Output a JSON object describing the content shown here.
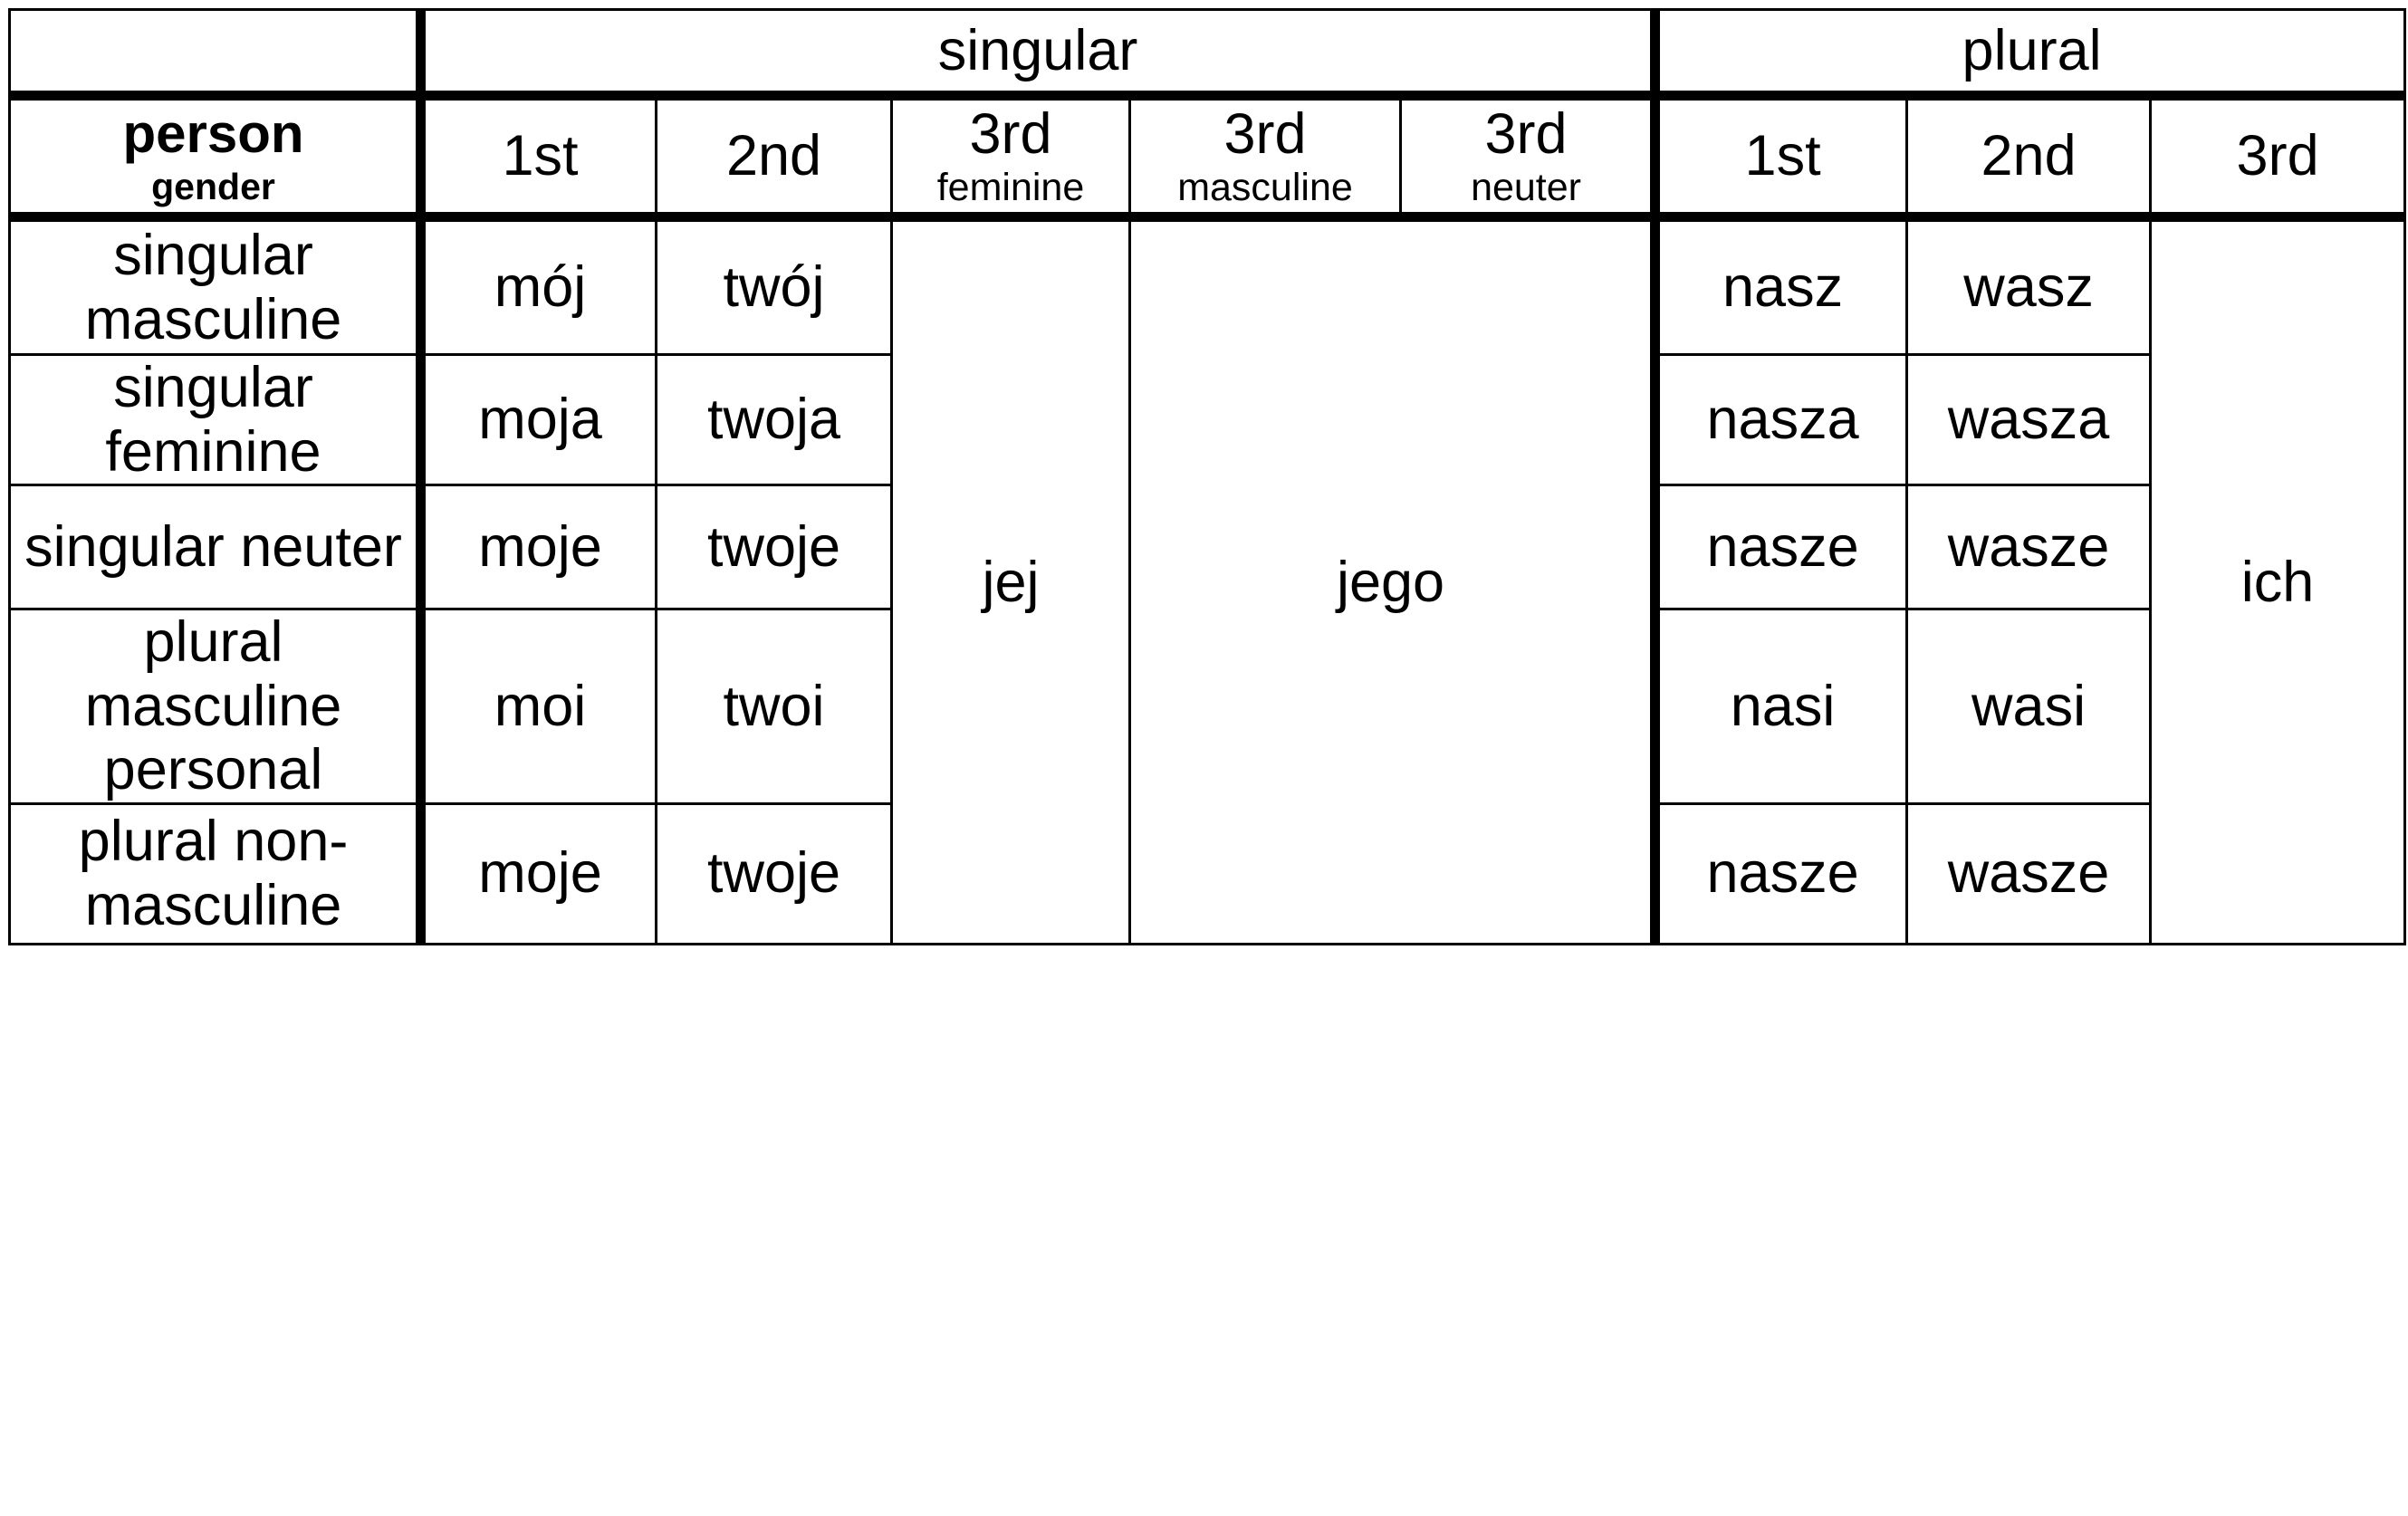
{
  "table": {
    "corner": {
      "person_label": "person",
      "gender_label": "gender"
    },
    "number_groups": [
      {
        "label": "singular",
        "span": 5
      },
      {
        "label": "plural",
        "span": 3
      }
    ],
    "person_columns": [
      {
        "main": "1st",
        "sub": ""
      },
      {
        "main": "2nd",
        "sub": ""
      },
      {
        "main": "3rd",
        "sub": "feminine"
      },
      {
        "main": "3rd",
        "sub": "masculine"
      },
      {
        "main": "3rd",
        "sub": "neuter"
      },
      {
        "main": "1st",
        "sub": ""
      },
      {
        "main": "2nd",
        "sub": ""
      },
      {
        "main": "3rd",
        "sub": ""
      }
    ],
    "row_labels": [
      "singular masculine",
      "singular feminine",
      "singular neuter",
      "plural masculine personal",
      "plural non-masculine"
    ],
    "cells": {
      "sg_1st": [
        "mój",
        "moja",
        "moje",
        "moi",
        "moje"
      ],
      "sg_2nd": [
        "twój",
        "twoja",
        "twoje",
        "twoi",
        "twoje"
      ],
      "sg_3rd_feminine": "jej",
      "sg_3rd_masculine_neuter": "jego",
      "pl_1st": [
        "nasz",
        "nasza",
        "nasze",
        "nasi",
        "nasze"
      ],
      "pl_2nd": [
        "wasz",
        "wasza",
        "wasze",
        "wasi",
        "wasze"
      ],
      "pl_3rd": "ich"
    }
  },
  "colors": {
    "border": "#000000",
    "text": "#000000",
    "background": "#ffffff"
  }
}
